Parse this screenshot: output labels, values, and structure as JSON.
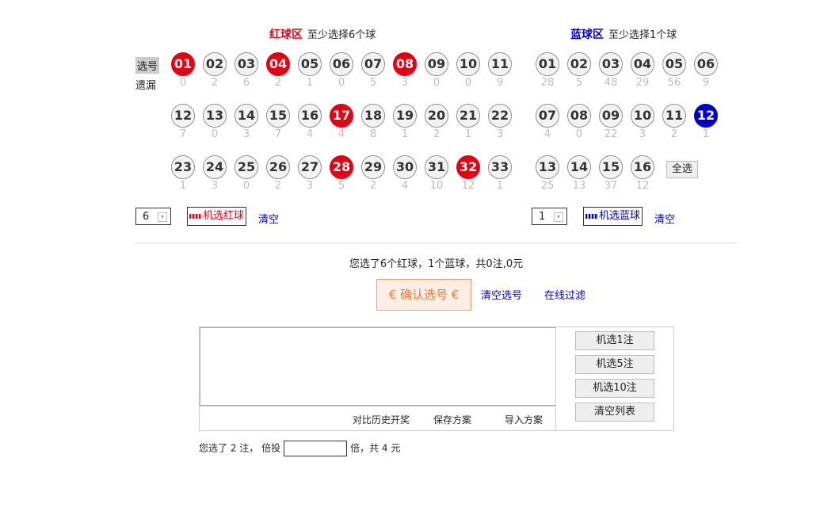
{
  "red_zone": {
    "name": "红球区",
    "hint": "至少选择6个球",
    "color": "#e60012",
    "label_select": "选号",
    "label_miss": "遗漏",
    "balls": [
      {
        "num": "01",
        "miss": "0",
        "selected": true
      },
      {
        "num": "02",
        "miss": "2",
        "selected": false
      },
      {
        "num": "03",
        "miss": "6",
        "selected": false
      },
      {
        "num": "04",
        "miss": "2",
        "selected": true
      },
      {
        "num": "05",
        "miss": "1",
        "selected": false
      },
      {
        "num": "06",
        "miss": "0",
        "selected": false
      },
      {
        "num": "07",
        "miss": "5",
        "selected": false
      },
      {
        "num": "08",
        "miss": "3",
        "selected": true
      },
      {
        "num": "09",
        "miss": "0",
        "selected": false
      },
      {
        "num": "10",
        "miss": "0",
        "selected": false
      },
      {
        "num": "11",
        "miss": "9",
        "selected": false
      },
      {
        "num": "12",
        "miss": "7",
        "selected": false
      },
      {
        "num": "13",
        "miss": "0",
        "selected": false
      },
      {
        "num": "14",
        "miss": "3",
        "selected": false
      },
      {
        "num": "15",
        "miss": "7",
        "selected": false
      },
      {
        "num": "16",
        "miss": "4",
        "selected": false
      },
      {
        "num": "17",
        "miss": "4",
        "selected": true
      },
      {
        "num": "18",
        "miss": "8",
        "selected": false
      },
      {
        "num": "19",
        "miss": "1",
        "selected": false
      },
      {
        "num": "20",
        "miss": "2",
        "selected": false
      },
      {
        "num": "21",
        "miss": "1",
        "selected": false
      },
      {
        "num": "22",
        "miss": "3",
        "selected": false
      },
      {
        "num": "23",
        "miss": "1",
        "selected": false
      },
      {
        "num": "24",
        "miss": "3",
        "selected": false
      },
      {
        "num": "25",
        "miss": "0",
        "selected": false
      },
      {
        "num": "26",
        "miss": "2",
        "selected": false
      },
      {
        "num": "27",
        "miss": "3",
        "selected": false
      },
      {
        "num": "28",
        "miss": "5",
        "selected": true
      },
      {
        "num": "29",
        "miss": "2",
        "selected": false
      },
      {
        "num": "30",
        "miss": "4",
        "selected": false
      },
      {
        "num": "31",
        "miss": "10",
        "selected": false
      },
      {
        "num": "32",
        "miss": "12",
        "selected": true
      },
      {
        "num": "33",
        "miss": "1",
        "selected": false
      }
    ],
    "count_value": "6",
    "random_label": "机选红球",
    "clear_label": "清空"
  },
  "blue_zone": {
    "name": "蓝球区",
    "hint": "至少选择1个球",
    "color": "#0000cc",
    "balls": [
      {
        "num": "01",
        "miss": "28",
        "selected": false
      },
      {
        "num": "02",
        "miss": "5",
        "selected": false
      },
      {
        "num": "03",
        "miss": "48",
        "selected": false
      },
      {
        "num": "04",
        "miss": "29",
        "selected": false
      },
      {
        "num": "05",
        "miss": "56",
        "selected": false
      },
      {
        "num": "06",
        "miss": "9",
        "selected": false
      },
      {
        "num": "07",
        "miss": "4",
        "selected": false
      },
      {
        "num": "08",
        "miss": "0",
        "selected": false
      },
      {
        "num": "09",
        "miss": "22",
        "selected": false
      },
      {
        "num": "10",
        "miss": "3",
        "selected": false
      },
      {
        "num": "11",
        "miss": "2",
        "selected": false
      },
      {
        "num": "12",
        "miss": "1",
        "selected": true
      },
      {
        "num": "13",
        "miss": "25",
        "selected": false
      },
      {
        "num": "14",
        "miss": "13",
        "selected": false
      },
      {
        "num": "15",
        "miss": "37",
        "selected": false
      },
      {
        "num": "16",
        "miss": "12",
        "selected": false
      }
    ],
    "select_all_label": "全选",
    "count_value": "1",
    "random_label": "机选蓝球",
    "clear_label": "清空"
  },
  "summary": "您选了6个红球，1个蓝球，共0注,0元",
  "confirm_label": "€ 确认选号 €",
  "clear_selection_label": "清空选号",
  "online_filter_label": "在线过滤",
  "list_actions": {
    "compare_history": "对比历史开奖",
    "save_plan": "保存方案",
    "import_plan": "导入方案"
  },
  "side_buttons": [
    "机选1注",
    "机选5注",
    "机选10注",
    "清空列表"
  ],
  "footer": {
    "prefix": "您选了 2 注， 倍投",
    "suffix": "倍，共 4 元"
  }
}
